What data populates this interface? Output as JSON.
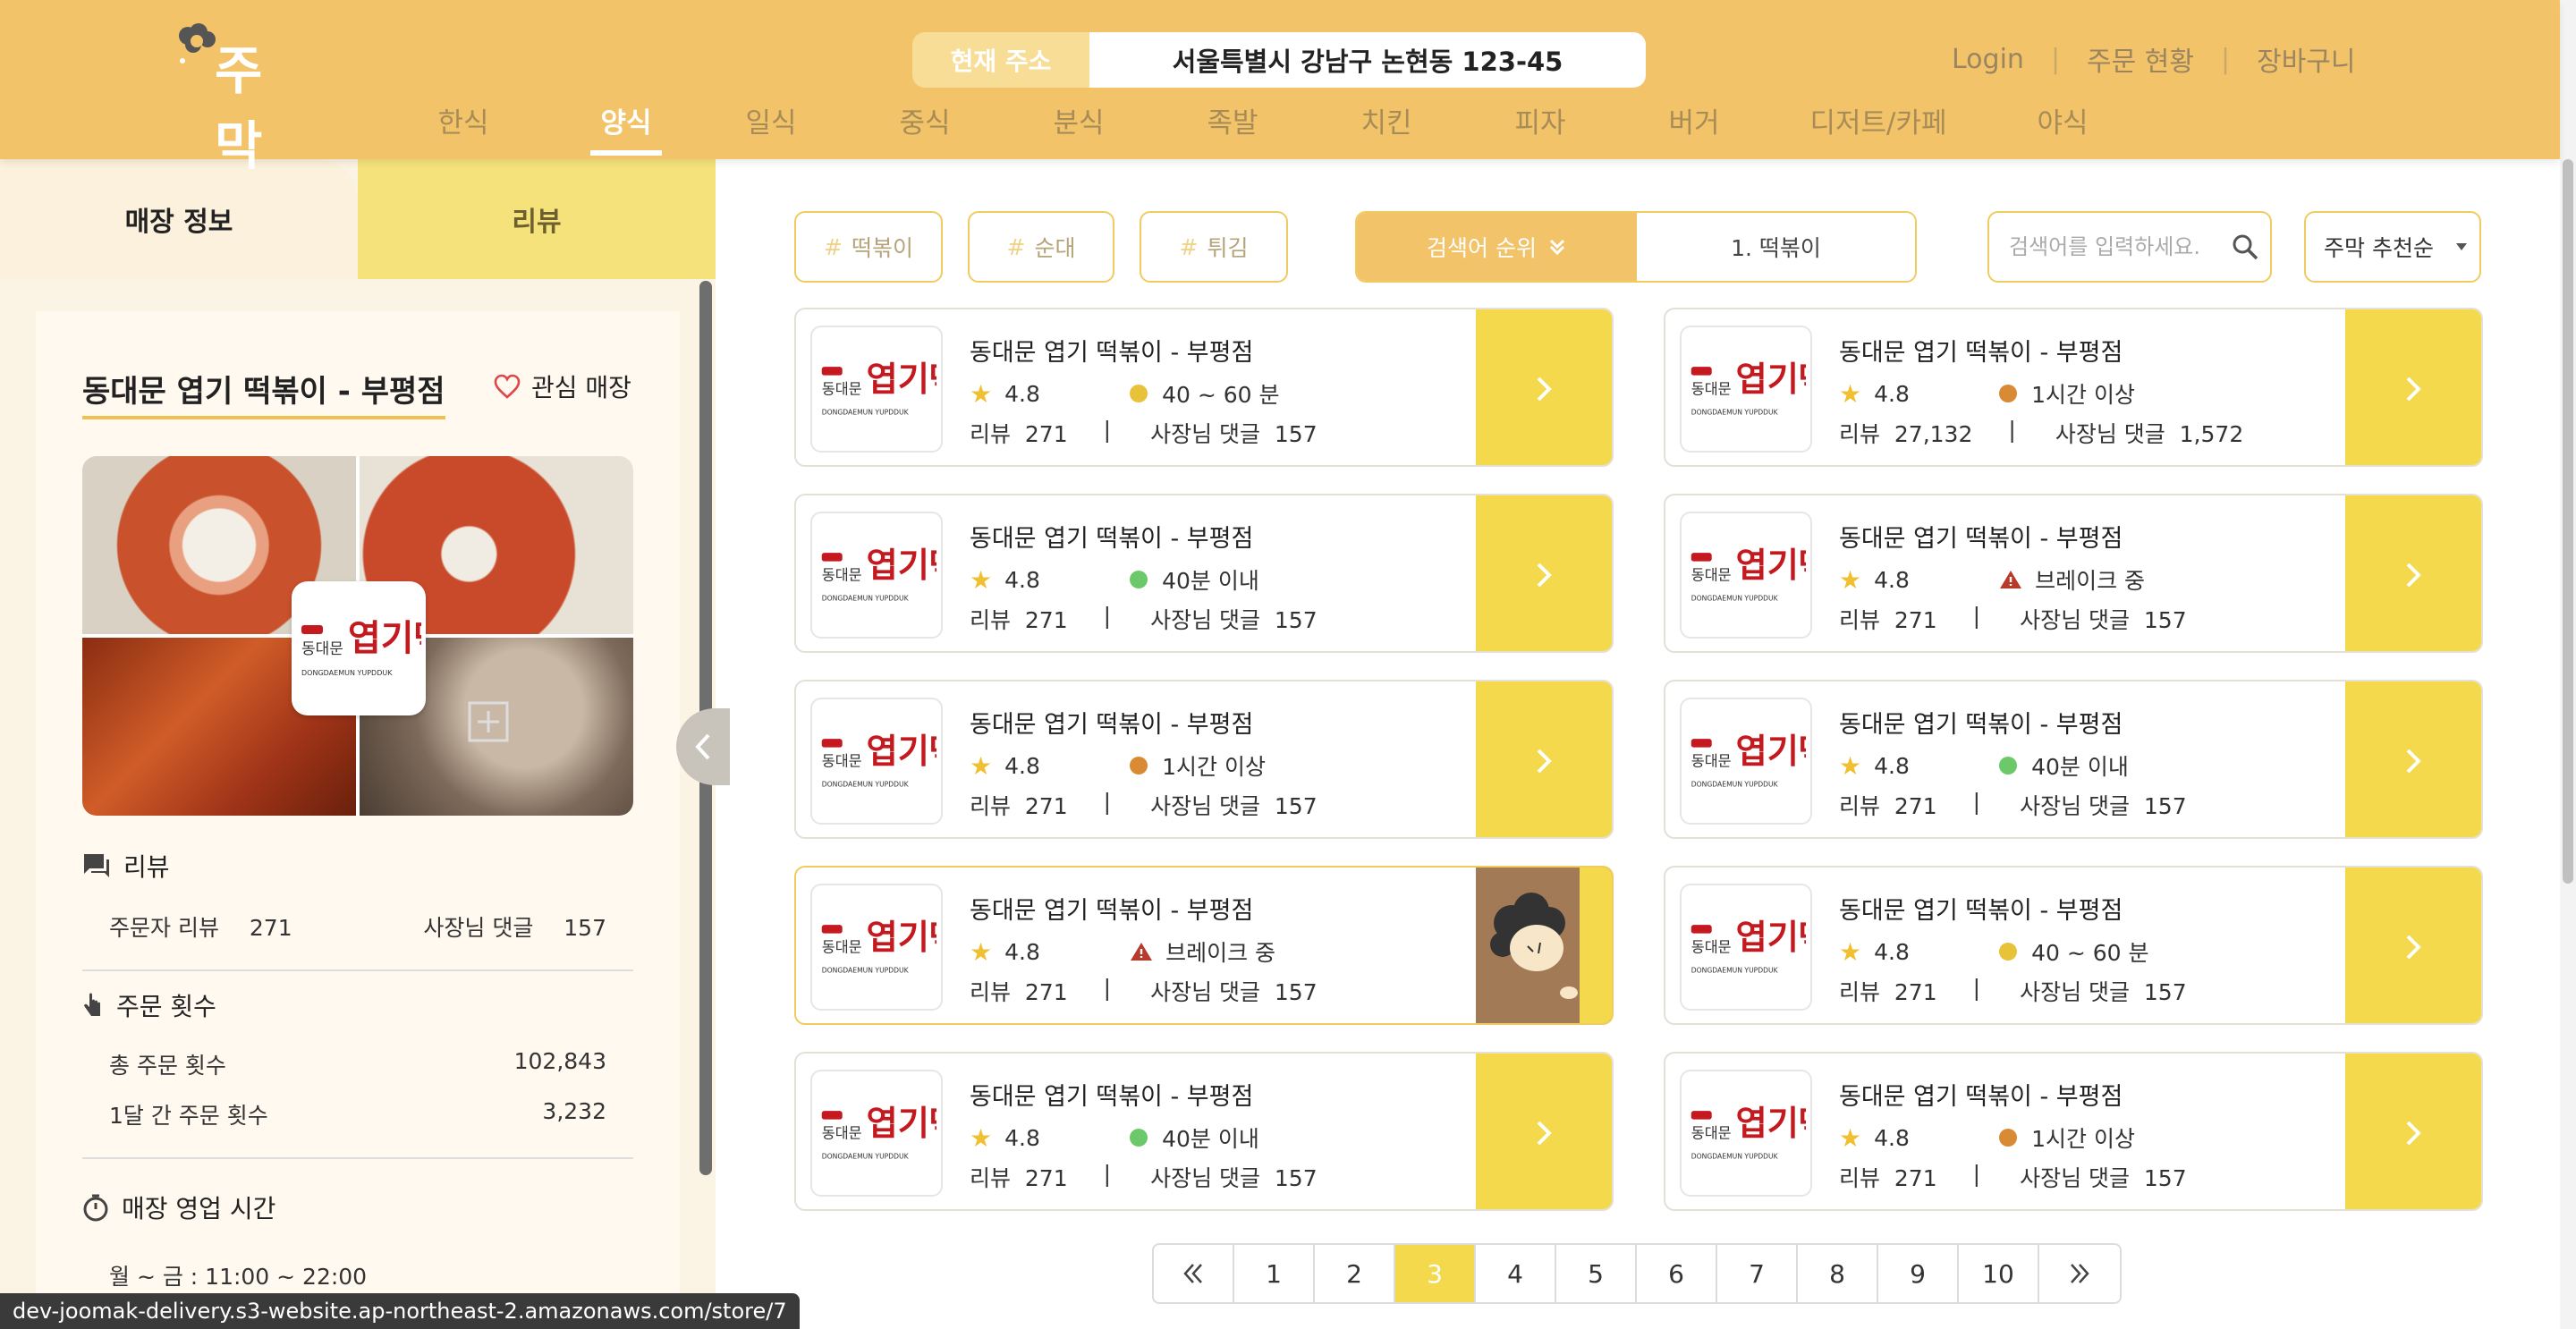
{
  "header": {
    "logo_text": "주막",
    "address_label": "현재 주소",
    "address_value": "서울특별시 강남구 논현동 123-45",
    "links": [
      "Login",
      "주문 현황",
      "장바구니"
    ],
    "categories": [
      "한식",
      "양식",
      "일식",
      "중식",
      "분식",
      "족발",
      "치킨",
      "피자",
      "버거",
      "디저트/카페",
      "야식"
    ],
    "active_category": "양식"
  },
  "left_panel": {
    "tabs": [
      "매장 정보",
      "리뷰"
    ],
    "store_name": "동대문 엽기 떡볶이 - 부평점",
    "favorite_label": "관심 매장",
    "review_section": {
      "title": "리뷰",
      "customer_reviews_label": "주문자 리뷰",
      "customer_reviews_value": "271",
      "owner_replies_label": "사장님 댓글",
      "owner_replies_value": "157"
    },
    "order_section": {
      "title": "주문 횟수",
      "total_label": "총 주문 횟수",
      "total_value": "102,843",
      "monthly_label": "1달 간 주문 횟수",
      "monthly_value": "3,232"
    },
    "hours_section": {
      "title": "매장 영업 시간",
      "weekday": "월 ~ 금 : 11:00 ~ 22:00"
    }
  },
  "filters": {
    "tags": [
      "떡볶이",
      "순대",
      "튀김"
    ],
    "rank_label": "검색어 순위",
    "rank_value": "1. 떡볶이",
    "search_placeholder": "검색어를 입력하세요.",
    "sort_label": "주막 추천순"
  },
  "store_cards": [
    {
      "name": "동대문 엽기 떡볶이 - 부평점",
      "rating": "4.8",
      "status": "40 ~ 60 분",
      "status_kind": "yellow",
      "reviews": "리뷰  271",
      "replies": "사장님 댓글  157"
    },
    {
      "name": "동대문 엽기 떡볶이 - 부평점",
      "rating": "4.8",
      "status": "1시간 이상",
      "status_kind": "orange",
      "reviews": "리뷰  27,132",
      "replies": "사장님 댓글  1,572"
    },
    {
      "name": "동대문 엽기 떡볶이 - 부평점",
      "rating": "4.8",
      "status": "40분 이내",
      "status_kind": "green",
      "reviews": "리뷰  271",
      "replies": "사장님 댓글  157"
    },
    {
      "name": "동대문 엽기 떡볶이 - 부평점",
      "rating": "4.8",
      "status": "브레이크 중",
      "status_kind": "break",
      "reviews": "리뷰  271",
      "replies": "사장님 댓글  157"
    },
    {
      "name": "동대문 엽기 떡볶이 - 부평점",
      "rating": "4.8",
      "status": "1시간 이상",
      "status_kind": "orange",
      "reviews": "리뷰  271",
      "replies": "사장님 댓글  157"
    },
    {
      "name": "동대문 엽기 떡볶이 - 부평점",
      "rating": "4.8",
      "status": "40분 이내",
      "status_kind": "green",
      "reviews": "리뷰  271",
      "replies": "사장님 댓글  157"
    },
    {
      "name": "동대문 엽기 떡볶이 - 부평점",
      "rating": "4.8",
      "status": "브레이크 중",
      "status_kind": "break",
      "reviews": "리뷰  271",
      "replies": "사장님 댓글  157"
    },
    {
      "name": "동대문 엽기 떡볶이 - 부평점",
      "rating": "4.8",
      "status": "40 ~ 60 분",
      "status_kind": "yellow",
      "reviews": "리뷰  271",
      "replies": "사장님 댓글  157"
    },
    {
      "name": "동대문 엽기 떡볶이 - 부평점",
      "rating": "4.8",
      "status": "40분 이내",
      "status_kind": "green",
      "reviews": "리뷰  271",
      "replies": "사장님 댓글  157"
    },
    {
      "name": "동대문 엽기 떡볶이 - 부평점",
      "rating": "4.8",
      "status": "1시간 이상",
      "status_kind": "orange",
      "reviews": "리뷰  271",
      "replies": "사장님 댓글  157"
    }
  ],
  "store_logo": {
    "line_top": "동대문",
    "big": "엽기떡볶이",
    "sub": "DONGDAEMUN YUPDDUK"
  },
  "status_colors": {
    "yellow": "#e8c33a",
    "orange": "#d98a35",
    "green": "#6cc96a",
    "break": "#b83a2b"
  },
  "pagination": {
    "pages": [
      "1",
      "2",
      "3",
      "4",
      "5",
      "6",
      "7",
      "8",
      "9",
      "10"
    ],
    "current": "3"
  },
  "status_url": "dev-joomak-delivery.s3-website.ap-northeast-2.amazonaws.com/store/7"
}
